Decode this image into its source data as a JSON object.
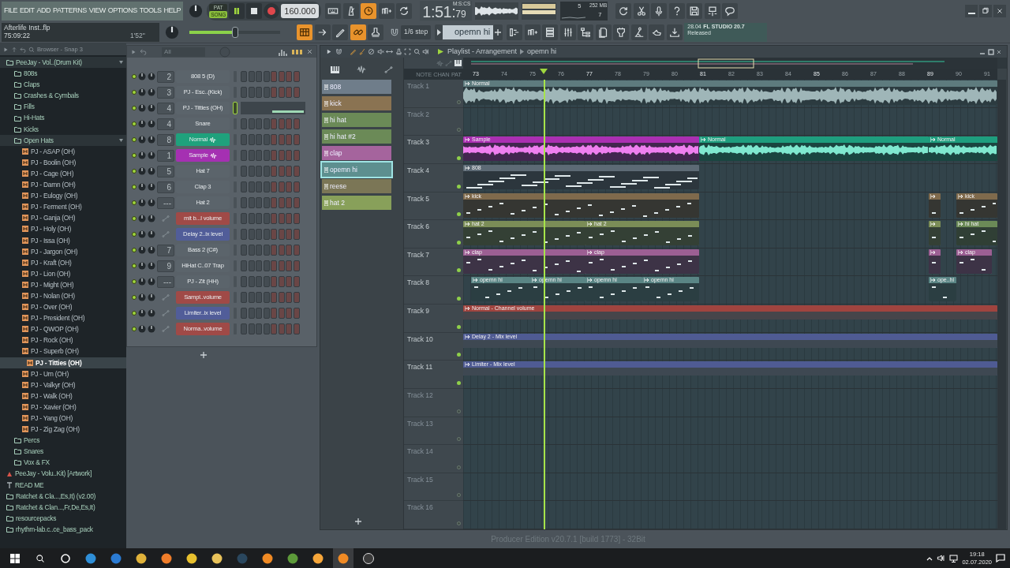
{
  "menu": [
    "FILE",
    "EDIT",
    "ADD",
    "PATTERNS",
    "VIEW",
    "OPTIONS",
    "TOOLS",
    "HELP"
  ],
  "hint_panel": {
    "file": "Afterlife Inst..flp",
    "position": "75:09:22",
    "duration": "1'52''"
  },
  "transport": {
    "modes": [
      {
        "label": "PAT",
        "selected": false
      },
      {
        "label": "SONG",
        "selected": true
      }
    ],
    "tempo": "160.000",
    "time": "1:51:",
    "centiseconds": "79",
    "units": "M:S:CS"
  },
  "toolbar_top": [
    {
      "kind": "typing",
      "on": false
    },
    {
      "kind": "metronome",
      "on": false
    },
    {
      "kind": "clock",
      "on": true
    },
    {
      "kind": "steps",
      "on": false
    },
    {
      "kind": "loop",
      "on": false
    }
  ],
  "toolbar_bottom": [
    {
      "kind": "pattern",
      "on": true
    },
    {
      "kind": "arrow",
      "on": false
    },
    {
      "kind": "pen",
      "on": false
    },
    {
      "kind": "link",
      "on": true
    },
    {
      "kind": "stamp",
      "on": false
    }
  ],
  "master_pitch": {
    "level": 0.5
  },
  "snap": "1/6 step",
  "pattern": "opemn hi",
  "cpu": {
    "cores": "5",
    "memory": "252 MB",
    "polyphony": "7"
  },
  "tools_top": [
    {
      "kind": "reset"
    },
    {
      "kind": "scissors"
    },
    {
      "kind": "mic"
    },
    {
      "kind": "help"
    },
    {
      "kind": "save"
    },
    {
      "kind": "export"
    },
    {
      "kind": "chat"
    }
  ],
  "tools_bottom": [
    {
      "kind": "pianoroll"
    },
    {
      "kind": "steps"
    },
    {
      "kind": "list"
    },
    {
      "kind": "mixer"
    },
    {
      "kind": "tree"
    },
    {
      "kind": "pages"
    },
    {
      "kind": "plug"
    },
    {
      "kind": "person"
    },
    {
      "kind": "hand"
    },
    {
      "kind": "download"
    }
  ],
  "news": {
    "date": "28.04",
    "title": "FL STUDIO 20.7",
    "subtitle": "Released"
  },
  "browser": {
    "title": "Browser - Snap 3",
    "items": [
      {
        "name": "PeeJay - Vol..(Drum Kit)",
        "kind": "folder",
        "expanded": true,
        "selected": false,
        "children": [
          {
            "name": "808s",
            "kind": "folder",
            "expanded": false,
            "selected": false
          },
          {
            "name": "Claps",
            "kind": "folder",
            "expanded": false,
            "selected": false
          },
          {
            "name": "Crashes & Cymbals",
            "kind": "folder",
            "expanded": false,
            "selected": false
          },
          {
            "name": "Fills",
            "kind": "folder",
            "expanded": false,
            "selected": false
          },
          {
            "name": "Hi-Hats",
            "kind": "folder",
            "expanded": false,
            "selected": false
          },
          {
            "name": "Kicks",
            "kind": "folder",
            "expanded": false,
            "selected": false
          },
          {
            "name": "Open Hats",
            "kind": "folder",
            "expanded": true,
            "selected": false,
            "children": [
              {
                "name": "PJ - ASAP (OH)",
                "kind": "file",
                "selected": false
              },
              {
                "name": "PJ - Boolin (OH)",
                "kind": "file",
                "selected": false
              },
              {
                "name": "PJ - Cage (OH)",
                "kind": "file",
                "selected": false
              },
              {
                "name": "PJ - Damn (OH)",
                "kind": "file",
                "selected": false
              },
              {
                "name": "PJ - Eulogy (OH)",
                "kind": "file",
                "selected": false
              },
              {
                "name": "PJ - Ferment (OH)",
                "kind": "file",
                "selected": false
              },
              {
                "name": "PJ - Ganja (OH)",
                "kind": "file",
                "selected": false
              },
              {
                "name": "PJ - Holy (OH)",
                "kind": "file",
                "selected": false
              },
              {
                "name": "PJ - Issa (OH)",
                "kind": "file",
                "selected": false
              },
              {
                "name": "PJ - Jargon (OH)",
                "kind": "file",
                "selected": false
              },
              {
                "name": "PJ - Kraft (OH)",
                "kind": "file",
                "selected": false
              },
              {
                "name": "PJ - Lion (OH)",
                "kind": "file",
                "selected": false
              },
              {
                "name": "PJ - Might (OH)",
                "kind": "file",
                "selected": false
              },
              {
                "name": "PJ - Nolan (OH)",
                "kind": "file",
                "selected": false
              },
              {
                "name": "PJ - Over (OH)",
                "kind": "file",
                "selected": false
              },
              {
                "name": "PJ - President (OH)",
                "kind": "file",
                "selected": false
              },
              {
                "name": "PJ - QWOP (OH)",
                "kind": "file",
                "selected": false
              },
              {
                "name": "PJ - Rock (OH)",
                "kind": "file",
                "selected": false
              },
              {
                "name": "PJ - Superb (OH)",
                "kind": "file",
                "selected": false
              },
              {
                "name": "PJ - Titties (OH)",
                "kind": "file",
                "selected": true
              },
              {
                "name": "PJ - Urn (OH)",
                "kind": "file",
                "selected": false
              },
              {
                "name": "PJ - Valkyr (OH)",
                "kind": "file",
                "selected": false
              },
              {
                "name": "PJ - Walk (OH)",
                "kind": "file",
                "selected": false
              },
              {
                "name": "PJ - Xavier (OH)",
                "kind": "file",
                "selected": false
              },
              {
                "name": "PJ - Yang (OH)",
                "kind": "file",
                "selected": false
              },
              {
                "name": "PJ - Zig Zag (OH)",
                "kind": "file",
                "selected": false
              }
            ]
          },
          {
            "name": "Percs",
            "kind": "folder",
            "expanded": false,
            "selected": false
          },
          {
            "name": "Snares",
            "kind": "folder",
            "expanded": false,
            "selected": false
          },
          {
            "name": "Vox & FX",
            "kind": "folder",
            "expanded": false,
            "selected": false
          }
        ]
      },
      {
        "name": "PeeJay - Volu..Kit) [Artwork]",
        "kind": "image",
        "selected": false
      },
      {
        "name": "READ ME",
        "kind": "text",
        "selected": false
      },
      {
        "name": "Ratchet & Cla...,Es,It) (v2.00)",
        "kind": "folder",
        "expanded": false,
        "selected": false
      },
      {
        "name": "Ratchet & Clan...,Fr,De,Es,It)",
        "kind": "folder",
        "expanded": false,
        "selected": false
      },
      {
        "name": "resourcepacks",
        "kind": "folder",
        "expanded": false,
        "selected": false
      },
      {
        "name": "rhythm-lab.c..ce_bass_pack",
        "kind": "folder",
        "expanded": false,
        "selected": false
      }
    ]
  },
  "channel_rack": {
    "filter": "All",
    "channels": [
      {
        "kind": "sampler",
        "number": "2",
        "name": "808 5 (D)",
        "color": "#5b646b",
        "selected": false
      },
      {
        "kind": "sampler",
        "number": "3",
        "name": "PJ - Esc..(Kick)",
        "color": "#5b646b",
        "selected": false
      },
      {
        "kind": "pianoroll",
        "number": "4",
        "name": "PJ - Titties (OH)",
        "color": "#5b646b",
        "selected": true
      },
      {
        "kind": "sampler",
        "number": "4",
        "name": "Snare",
        "color": "#5b646b",
        "selected": false
      },
      {
        "kind": "audio",
        "number": "8",
        "name": "Normal",
        "color": "#1fa17c",
        "selected": false
      },
      {
        "kind": "audio",
        "number": "1",
        "name": "Sample",
        "color": "#a530b2",
        "selected": false
      },
      {
        "kind": "sampler",
        "number": "5",
        "name": "Hat 7",
        "color": "#5b646b",
        "selected": false
      },
      {
        "kind": "sampler",
        "number": "6",
        "name": "Clap 3",
        "color": "#5b646b",
        "selected": false
      },
      {
        "kind": "sampler",
        "number": "---",
        "name": "Hat 2",
        "color": "#5b646b",
        "selected": false
      },
      {
        "kind": "automation",
        "name": "mit b...l volume",
        "color": "#a04a47",
        "selected": false
      },
      {
        "kind": "automation",
        "name": "Delay 2..ix level",
        "color": "#515d99",
        "selected": false
      },
      {
        "kind": "sampler",
        "number": "7",
        "name": "Bass 2 (C#)",
        "color": "#5b646b",
        "selected": false
      },
      {
        "kind": "sampler",
        "number": "9",
        "name": "HiHat C..07 Trap",
        "color": "#5b646b",
        "selected": false
      },
      {
        "kind": "sampler",
        "number": "---",
        "name": "PJ - Zit (HH)",
        "color": "#5b646b",
        "selected": false
      },
      {
        "kind": "automation",
        "name": "Sampl..volume",
        "color": "#a04a47",
        "selected": false
      },
      {
        "kind": "automation",
        "name": "Limiter..ix level",
        "color": "#515d99",
        "selected": false
      },
      {
        "kind": "automation",
        "name": "Norma..volume",
        "color": "#a04a47",
        "selected": false
      }
    ]
  },
  "playlist": {
    "title": "Playlist - Arrangement",
    "pattern": "opemn hi",
    "ruler_labels": [
      "NOTE",
      "CHAN",
      "PAT"
    ],
    "patterns": [
      {
        "name": "808",
        "color": "#6f7d8a",
        "selected": false
      },
      {
        "name": "kick",
        "color": "#8a7352",
        "selected": false
      },
      {
        "name": "hi hat",
        "color": "#6b8a57",
        "selected": false
      },
      {
        "name": "hi hat #2",
        "color": "#6b8a57",
        "selected": false
      },
      {
        "name": "clap",
        "color": "#a5649d",
        "selected": false
      },
      {
        "name": "opemn hi",
        "color": "#5d8f8f",
        "selected": true
      },
      {
        "name": "reese",
        "color": "#7b7656",
        "selected": false
      },
      {
        "name": "hat 2",
        "color": "#88a05a",
        "selected": false
      }
    ],
    "bars": [
      "73",
      "74",
      "75",
      "76",
      "77",
      "78",
      "79",
      "80",
      "81",
      "82",
      "83",
      "84",
      "85",
      "86",
      "87",
      "88",
      "89",
      "90",
      "91"
    ],
    "tracks": [
      {
        "name": "Track 1",
        "active": false,
        "clips": [
          {
            "kind": "audio",
            "label": "Normal",
            "color": "#5e7b7e"
          }
        ]
      },
      {
        "name": "Track 2",
        "active": false
      },
      {
        "name": "Track 3",
        "active": true,
        "clips": [
          {
            "kind": "audio",
            "label": "Sample",
            "color": "#ab2fb2"
          },
          {
            "kind": "audio",
            "label": "Normal",
            "color": "#1e9e7e"
          },
          {
            "kind": "audio",
            "label": "Normal",
            "color": "#1e9e7e"
          }
        ]
      },
      {
        "name": "Track 4",
        "active": true,
        "clips": [
          {
            "kind": "pattern",
            "label": "808",
            "color": "#5d6a75"
          }
        ]
      },
      {
        "name": "Track 5",
        "active": true,
        "clips": [
          {
            "kind": "pattern",
            "label": "kick",
            "color": "#7f6a4c"
          },
          {
            "kind": "pattern",
            "color": "#7f6a4c"
          },
          {
            "kind": "pattern",
            "label": "kick",
            "color": "#7f6a4c"
          }
        ]
      },
      {
        "name": "Track 6",
        "active": true,
        "clips": [
          {
            "kind": "pattern",
            "label": "hat 2",
            "color": "#7b8d57"
          },
          {
            "kind": "pattern",
            "label": "hat 2",
            "color": "#7b8d57"
          },
          {
            "kind": "pattern",
            "color": "#7b8d57"
          },
          {
            "kind": "pattern",
            "label": "hi hat",
            "color": "#6b8a57"
          }
        ]
      },
      {
        "name": "Track 7",
        "active": true,
        "clips": [
          {
            "kind": "pattern",
            "label": "clap",
            "color": "#9c5f93"
          },
          {
            "kind": "pattern",
            "label": "clap",
            "color": "#9c5f93"
          },
          {
            "kind": "pattern",
            "color": "#9c5f93"
          },
          {
            "kind": "pattern",
            "label": "clap",
            "color": "#9c5f93"
          }
        ]
      },
      {
        "name": "Track 8",
        "active": true,
        "clips": [
          {
            "kind": "pattern",
            "label": "opemn hi",
            "color": "#5a8585"
          },
          {
            "kind": "pattern",
            "label": "opemn hi",
            "color": "#5a8585"
          },
          {
            "kind": "pattern",
            "label": "opemn hi",
            "color": "#5a8585"
          },
          {
            "kind": "pattern",
            "label": "opemn hi",
            "color": "#5a8585"
          },
          {
            "kind": "pattern",
            "label": "ope..hi",
            "color": "#5a8585"
          }
        ]
      },
      {
        "name": "Track 9",
        "active": true,
        "clips": [
          {
            "kind": "automation",
            "label": "Normal - Channel volume",
            "color": "#a0443f"
          }
        ]
      },
      {
        "name": "Track 10",
        "active": true,
        "clips": [
          {
            "kind": "automation",
            "label": "Delay 2 - Mix level",
            "color": "#4f5b93"
          }
        ]
      },
      {
        "name": "Track 11",
        "active": true,
        "clips": [
          {
            "kind": "automation",
            "label": "Limiter - Mix level",
            "color": "#4f5b93"
          }
        ]
      },
      {
        "name": "Track 12",
        "active": false
      },
      {
        "name": "Track 13",
        "active": false
      },
      {
        "name": "Track 14",
        "active": false
      },
      {
        "name": "Track 15",
        "active": false
      },
      {
        "name": "Track 16",
        "active": false
      }
    ]
  },
  "status": "Producer Edition v20.7.1 [build 1773] - 32Bit",
  "taskbar": {
    "apps": [
      {
        "kind": "edge",
        "active": false
      },
      {
        "kind": "mail",
        "active": false
      },
      {
        "kind": "chrome",
        "active": false
      },
      {
        "kind": "firefox",
        "active": false
      },
      {
        "kind": "vivaldi",
        "active": false
      },
      {
        "kind": "explorer",
        "active": false
      },
      {
        "kind": "steam",
        "active": false
      },
      {
        "kind": "fl",
        "active": false
      },
      {
        "kind": "minecraft",
        "active": false
      },
      {
        "kind": "brave",
        "active": false
      },
      {
        "kind": "fl",
        "active": true
      },
      {
        "kind": "obs",
        "active": false
      }
    ],
    "time": "19:18",
    "date": "02.07.2020"
  }
}
